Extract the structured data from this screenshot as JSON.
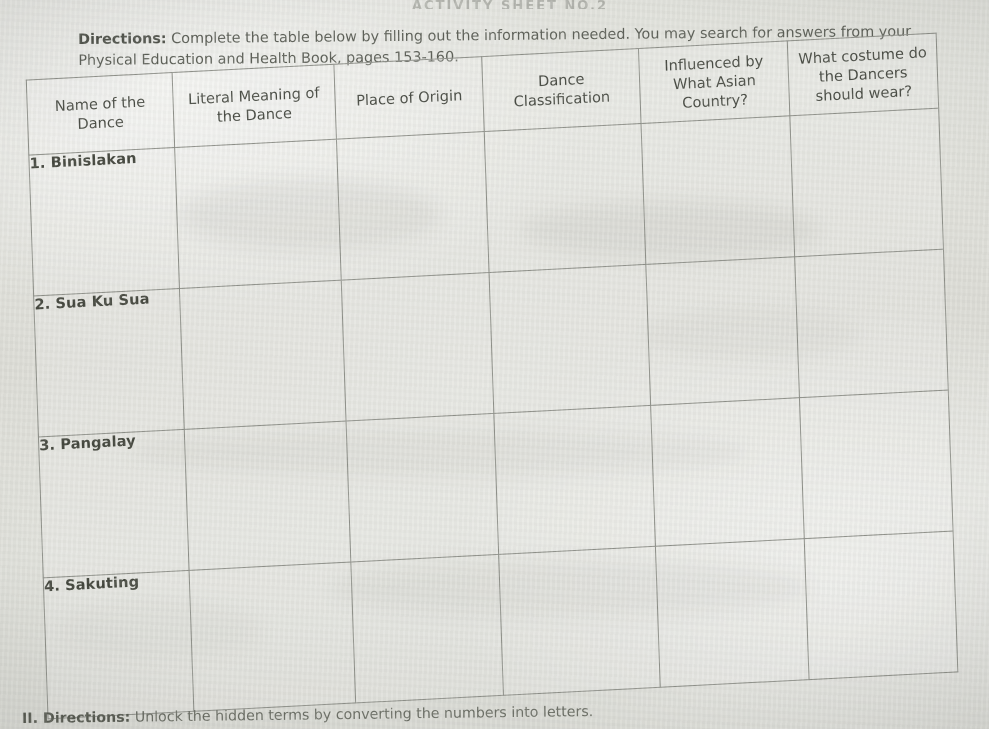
{
  "document": {
    "type": "scanned-worksheet-photo",
    "top_cut_text": "ACTIVITY SHEET NO.2",
    "paper_color": "#dfe0da",
    "ink_color": "#4a4d45",
    "rule_color": "#8e9089"
  },
  "section_one": {
    "label": "Directions:",
    "text": " Complete the table below by filling out the information needed. You may search for answers from your Physical Education and Health Book, pages 153-160."
  },
  "table": {
    "columns": [
      "Name of the Dance",
      "Literal Meaning of the Dance",
      "Place of Origin",
      "Dance Classification",
      "Influenced by What Asian Country?",
      "What costume do the Dancers should wear?"
    ],
    "rows": [
      {
        "label": "1. Binislakan",
        "cells": [
          "",
          "",
          "",
          "",
          ""
        ]
      },
      {
        "label": "2. Sua Ku Sua",
        "cells": [
          "",
          "",
          "",
          "",
          ""
        ]
      },
      {
        "label": "3. Pangalay",
        "cells": [
          "",
          "",
          "",
          "",
          ""
        ]
      },
      {
        "label": "4. Sakuting",
        "cells": [
          "",
          "",
          "",
          "",
          ""
        ]
      }
    ]
  },
  "section_two": {
    "label": "II. Directions:",
    "text": " Unlock the hidden terms by converting the numbers into letters."
  }
}
